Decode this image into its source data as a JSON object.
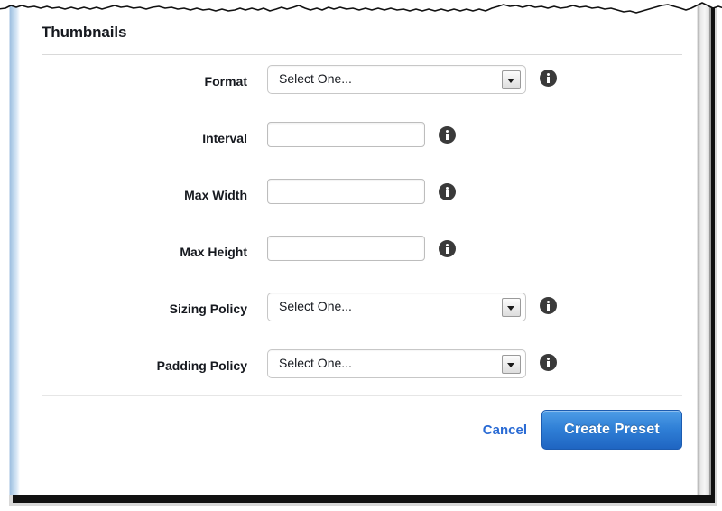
{
  "window": {
    "section_title": "Thumbnails"
  },
  "form": {
    "rows": [
      {
        "label": "Format",
        "control": "select",
        "value": "Select One...",
        "info": "info-icon"
      },
      {
        "label": "Interval",
        "control": "text",
        "value": "",
        "placeholder": "",
        "info": "info-icon"
      },
      {
        "label": "Max Width",
        "control": "text",
        "value": "",
        "placeholder": "",
        "info": "info-icon"
      },
      {
        "label": "Max Height",
        "control": "text",
        "value": "",
        "placeholder": "",
        "info": "info-icon"
      },
      {
        "label": "Sizing Policy",
        "control": "select",
        "value": "Select One...",
        "info": "info-icon"
      },
      {
        "label": "Padding Policy",
        "control": "select",
        "value": "Select One...",
        "info": "info-icon"
      }
    ]
  },
  "footer": {
    "cancel_label": "Cancel",
    "submit_label": "Create Preset"
  },
  "colors": {
    "primary_button": "#2f7fd6",
    "link": "#2a6bd4",
    "text": "#16191f",
    "info_icon": "#3a3a3a",
    "left_chrome": "#bcd5ec"
  }
}
